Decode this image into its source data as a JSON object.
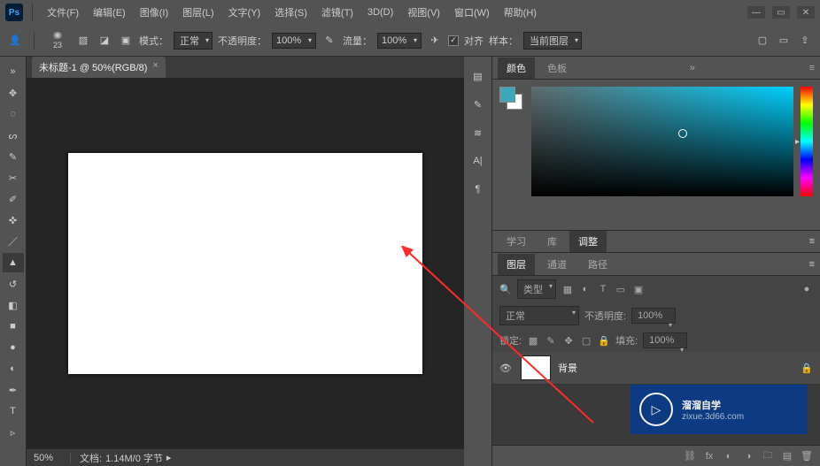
{
  "menu": {
    "items": [
      {
        "label": "文件(F)"
      },
      {
        "label": "编辑(E)"
      },
      {
        "label": "图像(I)"
      },
      {
        "label": "图层(L)"
      },
      {
        "label": "文字(Y)"
      },
      {
        "label": "选择(S)"
      },
      {
        "label": "滤镜(T)"
      },
      {
        "label": "3D(D)"
      },
      {
        "label": "视图(V)"
      },
      {
        "label": "窗口(W)"
      },
      {
        "label": "帮助(H)"
      }
    ]
  },
  "options": {
    "brush_size": "23",
    "mode_label": "模式：",
    "mode_value": "正常",
    "opacity_label": "不透明度：",
    "opacity_value": "100%",
    "flow_label": "流量：",
    "flow_value": "100%",
    "align_label": "对齐",
    "sample_label": "样本：",
    "sample_value": "当前图层"
  },
  "doc": {
    "tab_title": "未标题-1 @ 50%(RGB/8)",
    "zoom": "50%",
    "status_prefix": "文档:",
    "status": "1.14M/0 字节"
  },
  "panels": {
    "color": {
      "tabs": [
        "颜色",
        "色板"
      ],
      "fg_color": "#3aa8b8"
    },
    "learn": {
      "tabs": [
        "学习",
        "库",
        "调整"
      ]
    },
    "layers": {
      "tabs": [
        "图层",
        "通道",
        "路径"
      ],
      "kind_label": "类型",
      "blend": "正常",
      "opacity_label": "不透明度:",
      "opacity_value": "100%",
      "lock_label": "锁定:",
      "fill_label": "填充:",
      "fill_value": "100%",
      "items": [
        {
          "name": "背景"
        }
      ]
    }
  },
  "watermark": {
    "title": "溜溜自学",
    "sub": "zixue.3d66.com"
  }
}
